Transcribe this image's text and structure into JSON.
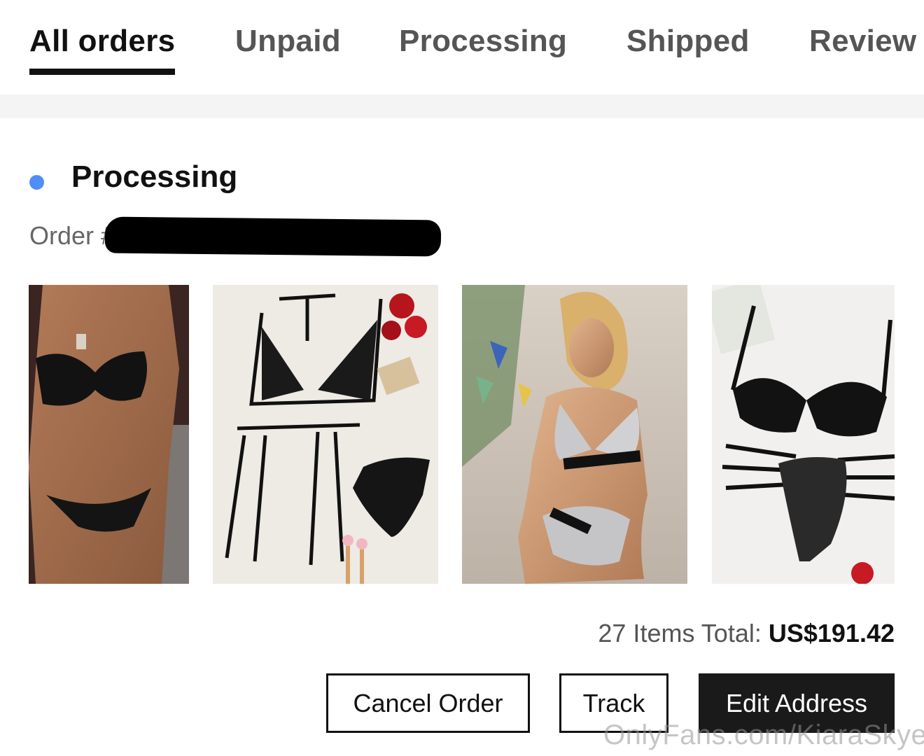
{
  "tabs": [
    {
      "label": "All orders",
      "active": true
    },
    {
      "label": "Unpaid",
      "active": false
    },
    {
      "label": "Processing",
      "active": false
    },
    {
      "label": "Shipped",
      "active": false
    },
    {
      "label": "Review",
      "active": false
    }
  ],
  "order": {
    "status": "Processing",
    "status_color": "#4f8ef7",
    "number_label": "Order #",
    "number_redacted": true,
    "products": [
      {
        "name": "black satin bra and panty set",
        "icon": "product-photo"
      },
      {
        "name": "black strappy lingerie set with garter",
        "icon": "product-photo"
      },
      {
        "name": "silver sequin bra and panty set",
        "icon": "product-photo"
      },
      {
        "name": "black lace strappy lingerie set",
        "icon": "product-photo"
      }
    ],
    "total_prefix": "27 Items Total: ",
    "total_amount": "US$191.42"
  },
  "actions": {
    "cancel_label": "Cancel Order",
    "track_label": "Track",
    "edit_address_label": "Edit Address"
  },
  "watermark": "OnlyFans.com/KiaraSkye"
}
